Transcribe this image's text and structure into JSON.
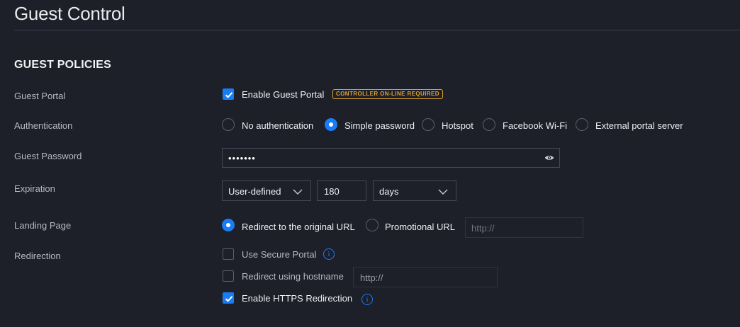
{
  "page": {
    "title": "Guest Control"
  },
  "section": {
    "title": "GUEST POLICIES"
  },
  "labels": {
    "guest_portal": "Guest Portal",
    "authentication": "Authentication",
    "guest_password": "Guest Password",
    "expiration": "Expiration",
    "landing_page": "Landing Page",
    "redirection": "Redirection"
  },
  "guest_portal": {
    "enable_label": "Enable Guest Portal",
    "enabled": true,
    "badge": "CONTROLLER ON-LINE REQUIRED"
  },
  "authentication": {
    "options": [
      {
        "label": "No authentication",
        "selected": false
      },
      {
        "label": "Simple password",
        "selected": true
      },
      {
        "label": "Hotspot",
        "selected": false
      },
      {
        "label": "Facebook Wi-Fi",
        "selected": false
      },
      {
        "label": "External portal server",
        "selected": false
      }
    ]
  },
  "guest_password": {
    "masked_value": "•••••••",
    "icon": "eye-icon"
  },
  "expiration": {
    "mode": "User-defined",
    "amount": "180",
    "unit": "days"
  },
  "landing_page": {
    "options": [
      {
        "label": "Redirect to the original URL",
        "selected": true
      },
      {
        "label": "Promotional URL",
        "selected": false
      }
    ],
    "promo_placeholder": "http://"
  },
  "redirection": {
    "use_secure_portal": {
      "label": "Use Secure Portal",
      "checked": false
    },
    "redirect_hostname": {
      "label": "Redirect using hostname",
      "checked": false,
      "placeholder": "http://"
    },
    "https_redirection": {
      "label": "Enable HTTPS Redirection",
      "checked": true
    }
  },
  "colors": {
    "accent": "#1a7cf5",
    "badge": "#e0a22a",
    "background": "#1d1f29"
  }
}
